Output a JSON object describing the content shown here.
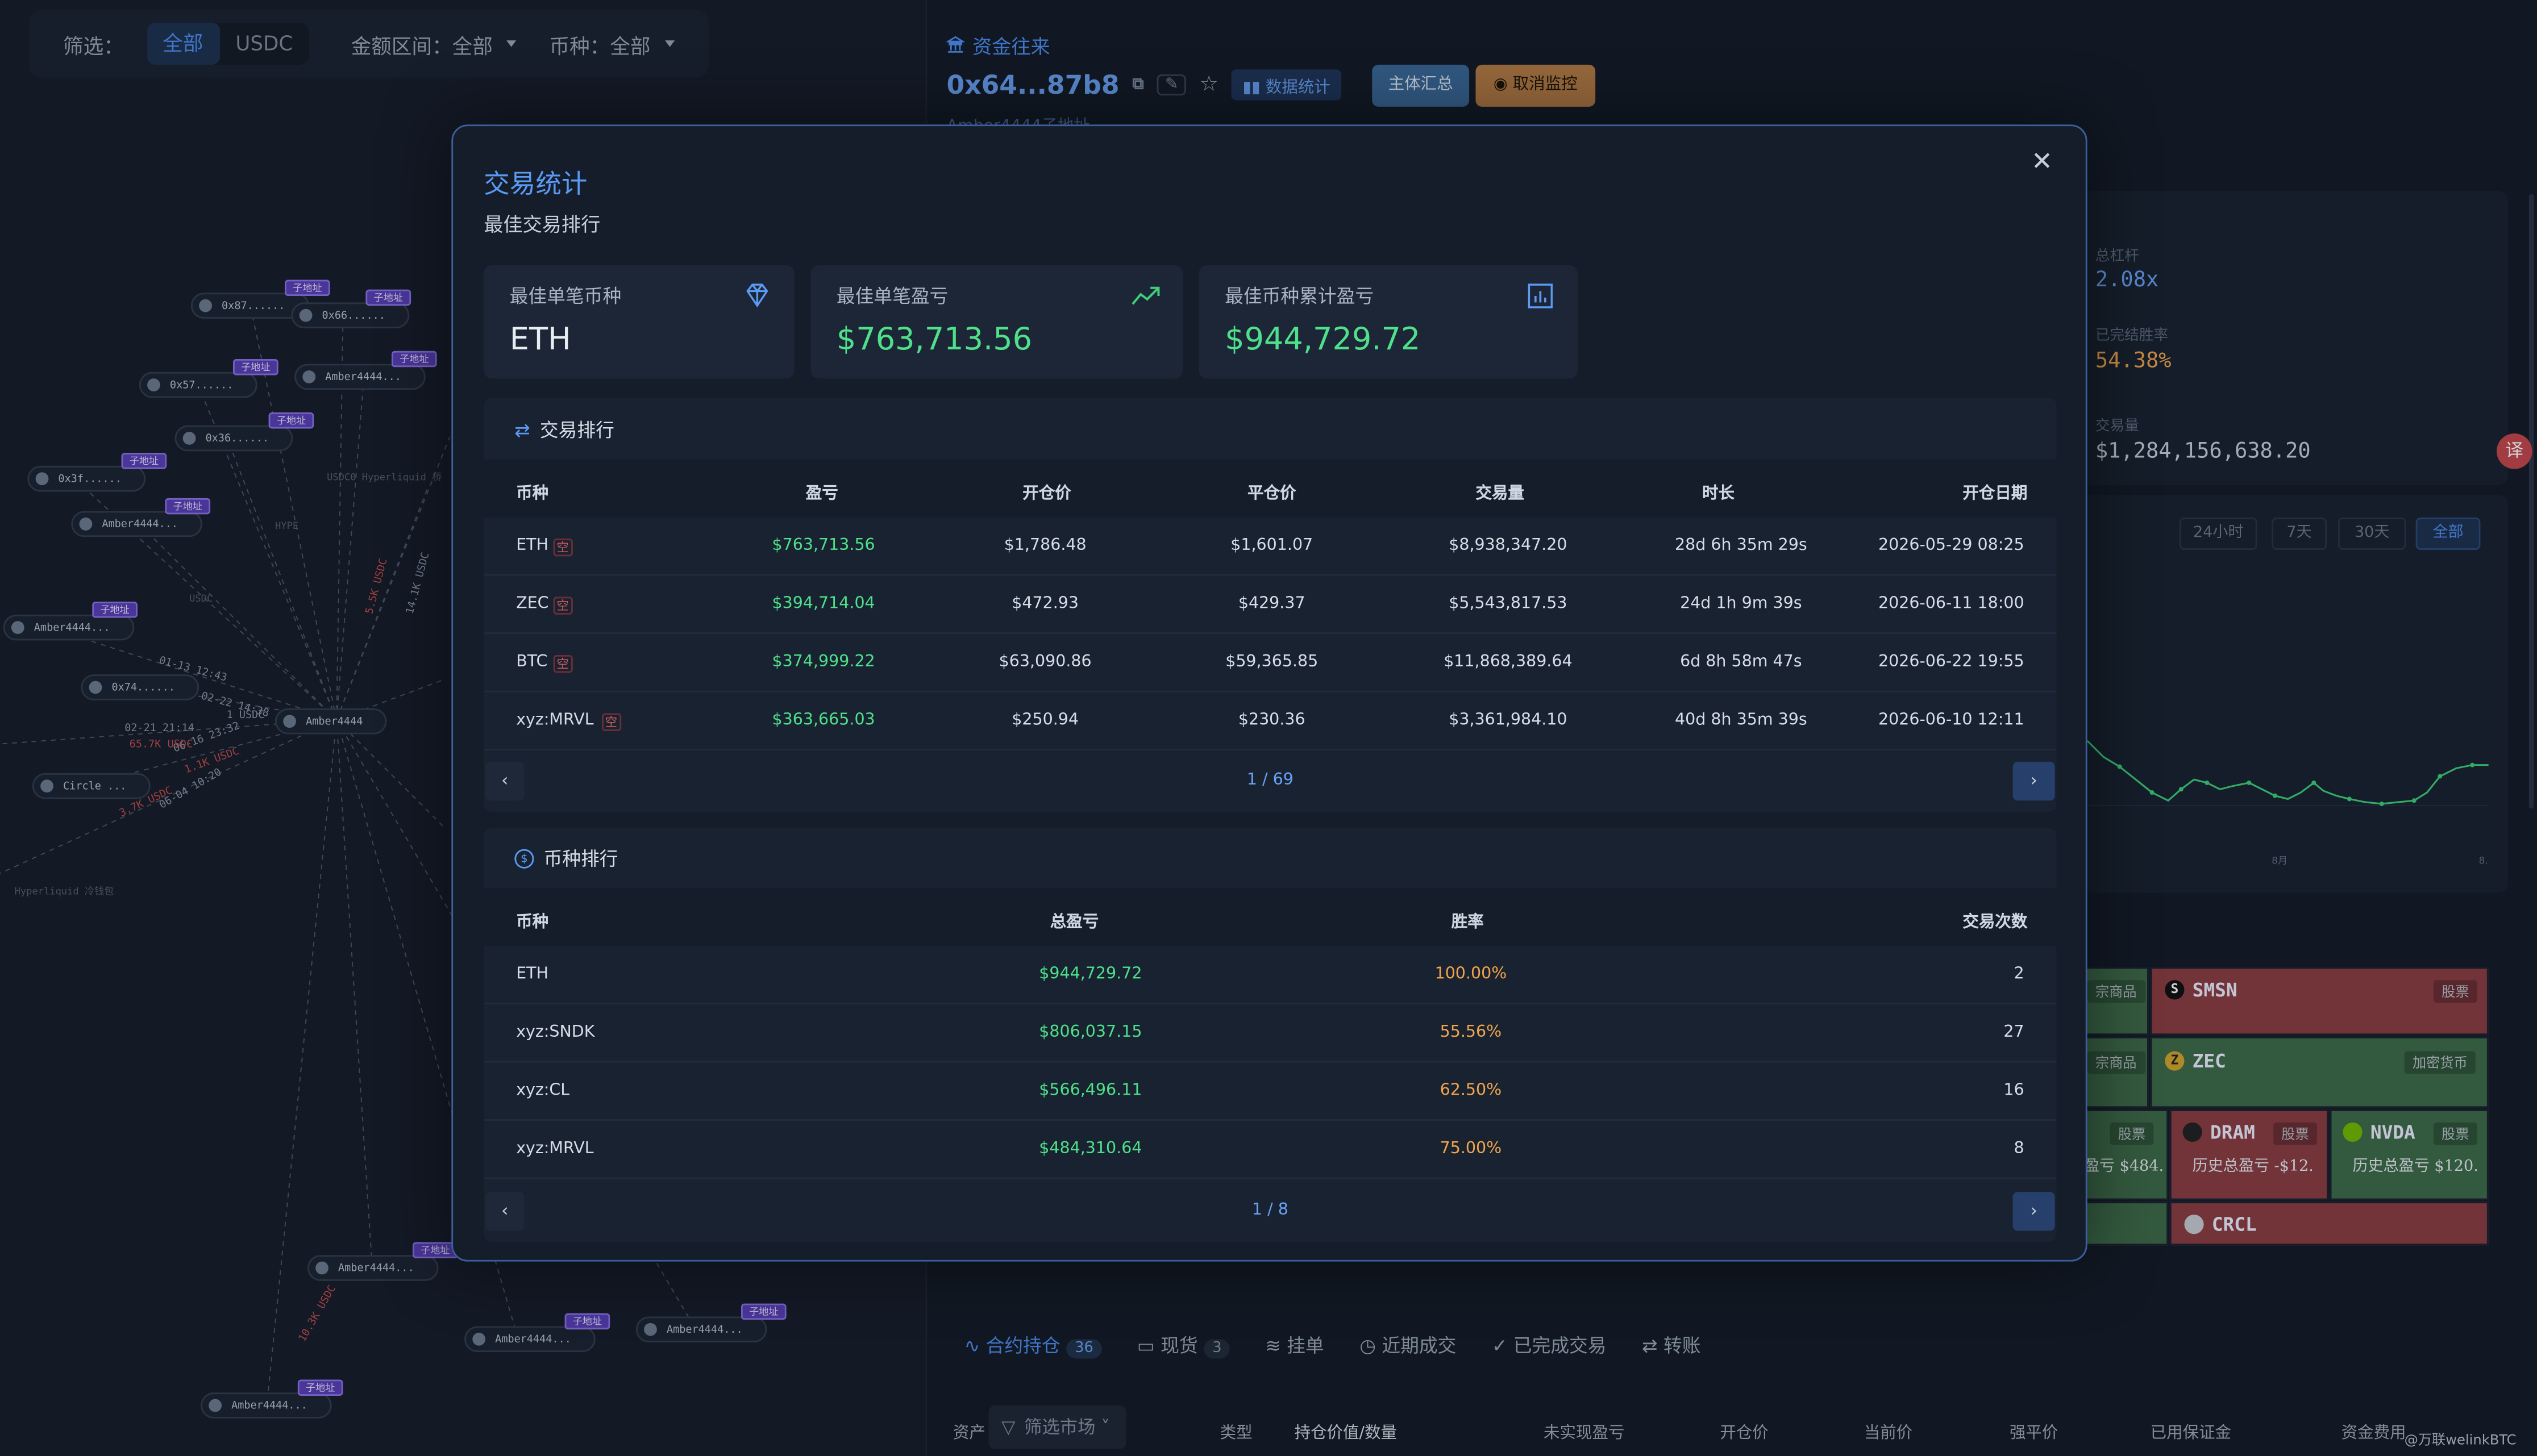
{
  "filter": {
    "label": "筛选：",
    "options": [
      "全部",
      "USDC"
    ],
    "amount_range": "金额区间：全部",
    "currency": "币种：全部"
  },
  "graph": {
    "nodes": [
      "0x87......",
      "0x66......",
      "0x57......",
      "Amber4444...",
      "0x36......",
      "0x3f......",
      "Amber4444...",
      "Amber4444...",
      "0x74......",
      "Amber4444",
      "Circle ...",
      "Amber4444...",
      "Amber4444...",
      "Amber4444...",
      "Amber4444..."
    ],
    "node_badge": "子地址",
    "faint_labels": [
      "USDC0 Hyperliquid 桥",
      "HYPE",
      "USDC",
      "Hyperliquid 冷钱包"
    ],
    "edge_labels": [
      "01-13 12:43",
      "02-22 14:38",
      "02-21 21:14",
      "06-16 23:32",
      "06-04 10:20",
      "65.7K USDC",
      "1.1K USDC",
      "3.7K USDC",
      "1 USDC",
      "5.5K USDC",
      "10.3K USDC",
      "14.1K USDC"
    ]
  },
  "right": {
    "section_title": "资金往来",
    "address": "0x64...87b8",
    "data_stats_label": "数据统计",
    "sub_address": "Amber4444子地址",
    "summary_button": "主体汇总",
    "cancel_monitor_button": "取消监控",
    "stats": [
      {
        "label": "总杠杆",
        "value": "2.08x",
        "color": "#6aa2f5"
      },
      {
        "label": "已完结胜率",
        "value": "54.38%",
        "color": "#f0a44c"
      },
      {
        "label": "交易量",
        "value": "$1,284,156,638.20",
        "color": "#c5cfdc"
      }
    ],
    "ranges": [
      "24小时",
      "7天",
      "30天",
      "全部"
    ],
    "chart_axis": [
      "8月",
      "8."
    ],
    "heatmap": [
      {
        "name": "SMSN",
        "tag": "股票"
      },
      {
        "name": "ZEC",
        "tag": "加密货币"
      },
      {
        "name": "DRAM",
        "tag": "股票",
        "pnl": "历史总盈亏 -$12."
      },
      {
        "name": "NVDA",
        "tag": "股票",
        "pnl": "历史总盈亏 $120."
      },
      {
        "name": "CRCL",
        "tag": ""
      }
    ],
    "heat_partial": [
      "宗商品",
      "宗商品",
      "股票",
      "盈亏 $484."
    ],
    "tabs": [
      {
        "label": "合约持仓",
        "count": "36"
      },
      {
        "label": "现货",
        "count": "3"
      },
      {
        "label": "挂单",
        "count": ""
      },
      {
        "label": "近期成交",
        "count": ""
      },
      {
        "label": "已完成交易",
        "count": ""
      },
      {
        "label": "转账",
        "count": ""
      }
    ],
    "columns": [
      "资产",
      "类型",
      "持仓价值/数量",
      "未实现盈亏",
      "开仓价",
      "当前价",
      "强平价",
      "已用保证金",
      "资金费用"
    ],
    "market_filter": "筛选市场",
    "watermark": "@万联welinkBTC"
  },
  "modal": {
    "title": "交易统计",
    "subtitle": "最佳交易排行",
    "cards": [
      {
        "label": "最佳单笔币种",
        "value": "ETH",
        "icon": "diamond-icon"
      },
      {
        "label": "最佳单笔盈亏",
        "value": "$763,713.56",
        "icon": "trend-up-icon"
      },
      {
        "label": "最佳币种累计盈亏",
        "value": "$944,729.72",
        "icon": "bar-chart-icon"
      }
    ],
    "trade_rank": {
      "title": "交易排行",
      "headers": [
        "币种",
        "盈亏",
        "开仓价",
        "平仓价",
        "交易量",
        "时长",
        "开仓日期"
      ],
      "short_tag": "空",
      "rows": [
        [
          "ETH",
          "$763,713.56",
          "$1,786.48",
          "$1,601.07",
          "$8,938,347.20",
          "28d 6h 35m 29s",
          "2026-05-29 08:25"
        ],
        [
          "ZEC",
          "$394,714.04",
          "$472.93",
          "$429.37",
          "$5,543,817.53",
          "24d 1h 9m 39s",
          "2026-06-11 18:00"
        ],
        [
          "BTC",
          "$374,999.22",
          "$63,090.86",
          "$59,365.85",
          "$11,868,389.64",
          "6d 8h 58m 47s",
          "2026-06-22 19:55"
        ],
        [
          "xyz:MRVL",
          "$363,665.03",
          "$250.94",
          "$230.36",
          "$3,361,984.10",
          "40d 8h 35m 39s",
          "2026-06-10 12:11"
        ]
      ],
      "page": "1 / 69"
    },
    "coin_rank": {
      "title": "币种排行",
      "headers": [
        "币种",
        "总盈亏",
        "胜率",
        "交易次数"
      ],
      "rows": [
        [
          "ETH",
          "$944,729.72",
          "100.00%",
          "2"
        ],
        [
          "xyz:SNDK",
          "$806,037.15",
          "55.56%",
          "27"
        ],
        [
          "xyz:CL",
          "$566,496.11",
          "62.50%",
          "16"
        ],
        [
          "xyz:MRVL",
          "$484,310.64",
          "75.00%",
          "8"
        ]
      ],
      "page": "1 / 8"
    }
  }
}
